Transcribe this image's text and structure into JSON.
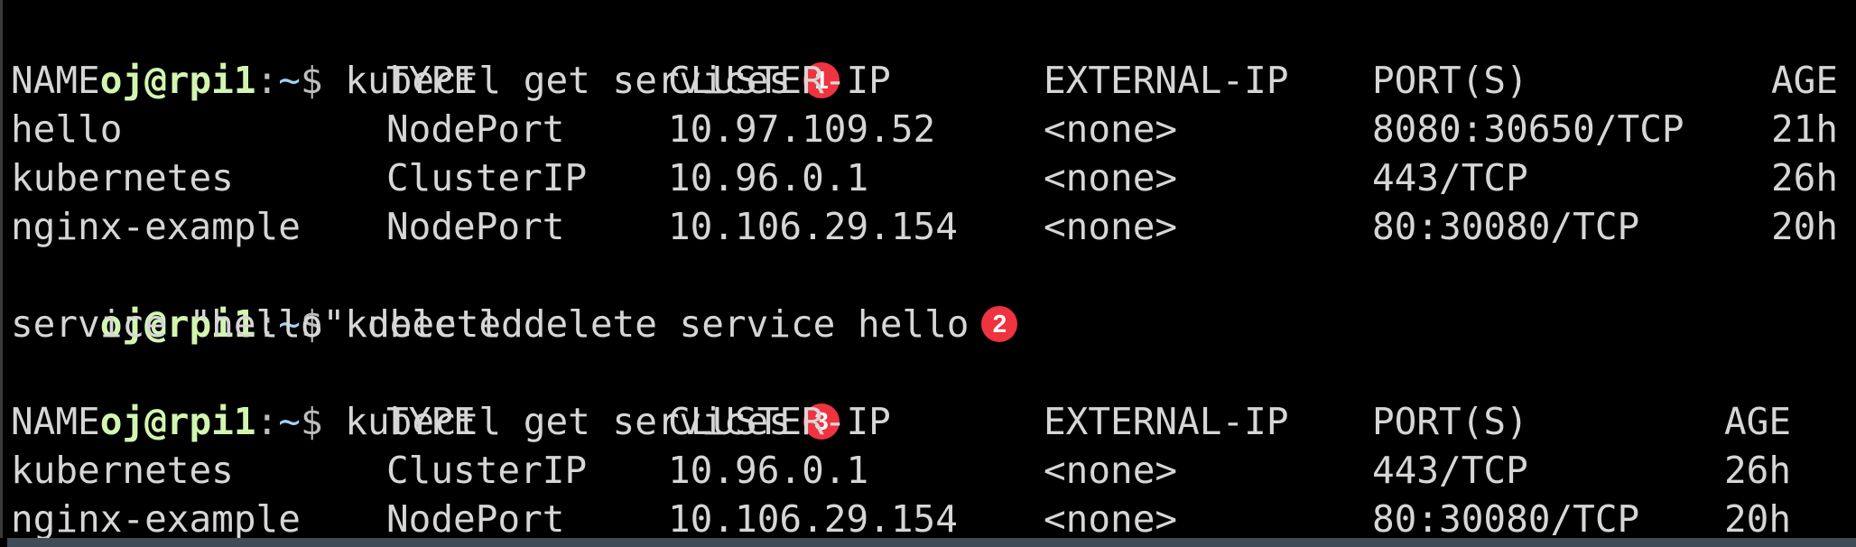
{
  "prompt": {
    "user_host": "oj@rpi1",
    "colon": ":",
    "path": "~",
    "symbol": "$"
  },
  "session": [
    {
      "type": "command",
      "command": "kubectl get services",
      "badge": "1"
    },
    {
      "type": "table",
      "headers": [
        "NAME",
        "TYPE",
        "CLUSTER-IP",
        "EXTERNAL-IP",
        "PORT(S)",
        "AGE"
      ],
      "rows": [
        [
          "hello",
          "NodePort",
          "10.97.109.52",
          "<none>",
          "8080:30650/TCP",
          "21h"
        ],
        [
          "kubernetes",
          "ClusterIP",
          "10.96.0.1",
          "<none>",
          "443/TCP",
          "26h"
        ],
        [
          "nginx-example",
          "NodePort",
          "10.106.29.154",
          "<none>",
          "80:30080/TCP",
          "20h"
        ]
      ]
    },
    {
      "type": "command",
      "command": "kubectl delete service hello",
      "badge": "2"
    },
    {
      "type": "output",
      "text": "service \"hello\" deleted"
    },
    {
      "type": "command",
      "command": "kubectl get services",
      "badge": "3"
    },
    {
      "type": "table",
      "headers": [
        "NAME",
        "TYPE",
        "CLUSTER-IP",
        "EXTERNAL-IP",
        "PORT(S)",
        "AGE"
      ],
      "rows": [
        [
          "kubernetes",
          "ClusterIP",
          "10.96.0.1",
          "<none>",
          "443/TCP",
          "26h"
        ],
        [
          "nginx-example",
          "NodePort",
          "10.106.29.154",
          "<none>",
          "80:30080/TCP",
          "20h"
        ]
      ]
    }
  ],
  "colors": {
    "background": "#000000",
    "prompt_user": "#d2f5b0",
    "prompt_path": "#9fd3f3",
    "text": "#d6d6d6",
    "badge": "#ef3340"
  }
}
